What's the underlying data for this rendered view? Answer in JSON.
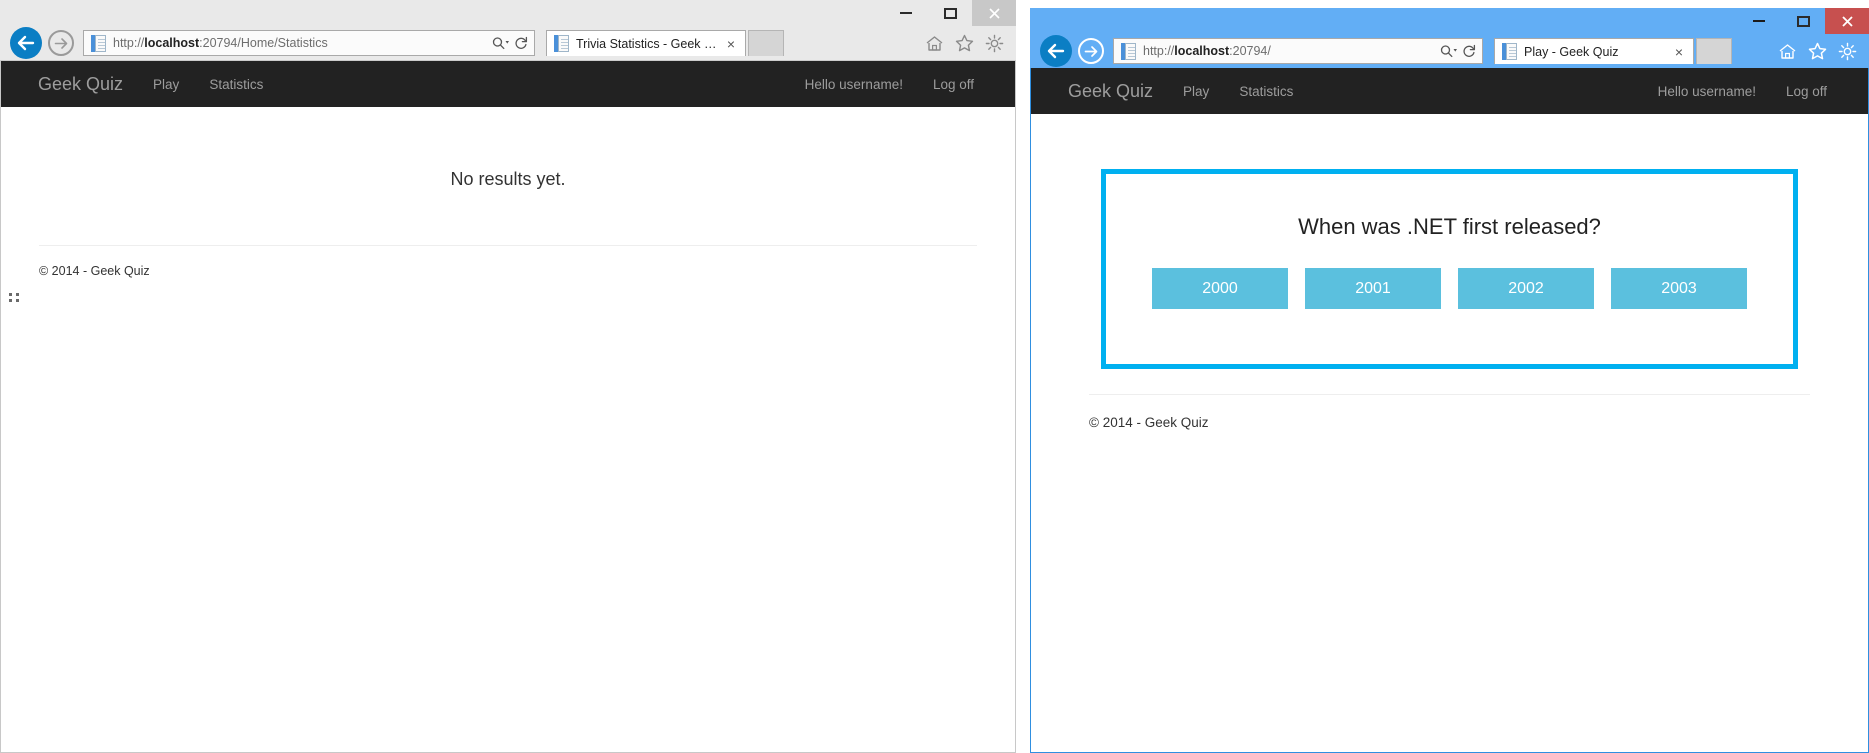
{
  "windows": {
    "left": {
      "state": "inactive",
      "url": "http://localhost:20794/Home/Statistics",
      "url_host": "localhost",
      "url_prefix": "http://",
      "url_suffix": ":20794/Home/Statistics",
      "tab_title": "Trivia Statistics - Geek Quiz",
      "tab_close_label": "×",
      "controls": {
        "minimize": "–",
        "maximize": "□",
        "close": "✕"
      },
      "site": {
        "brand": "Geek Quiz",
        "nav": [
          {
            "label": "Play"
          },
          {
            "label": "Statistics"
          }
        ],
        "nav_right": [
          {
            "label": "Hello username!"
          },
          {
            "label": "Log off"
          }
        ],
        "message": "No results yet.",
        "footer": "© 2014 - Geek Quiz"
      }
    },
    "right": {
      "state": "active",
      "url": "http://localhost:20794/",
      "url_host": "localhost",
      "url_prefix": "http://",
      "url_suffix": ":20794/",
      "tab_title": "Play - Geek Quiz",
      "tab_close_label": "×",
      "controls": {
        "minimize": "–",
        "maximize": "□",
        "close": "✕"
      },
      "site": {
        "brand": "Geek Quiz",
        "nav": [
          {
            "label": "Play"
          },
          {
            "label": "Statistics"
          }
        ],
        "nav_right": [
          {
            "label": "Hello username!"
          },
          {
            "label": "Log off"
          }
        ],
        "quiz": {
          "question": "When was .NET first released?",
          "answers": [
            {
              "label": "2000"
            },
            {
              "label": "2001"
            },
            {
              "label": "2002"
            },
            {
              "label": "2003"
            }
          ]
        },
        "footer": "© 2014 - Geek Quiz"
      }
    }
  },
  "icons": {
    "back": "back-arrow-icon",
    "forward": "forward-arrow-icon",
    "page": "page-icon",
    "search": "search-icon",
    "refresh": "refresh-icon",
    "home": "home-icon",
    "favorites": "star-icon",
    "settings": "gear-icon"
  },
  "colors": {
    "navbar": "#222222",
    "card_border": "#00b0f0",
    "answer_button": "#5bc0de",
    "active_titlebar": "#62aef5",
    "inactive_titlebar": "#e9e9e9",
    "close_active": "#c7504f",
    "back_button": "#0b7ec4"
  }
}
